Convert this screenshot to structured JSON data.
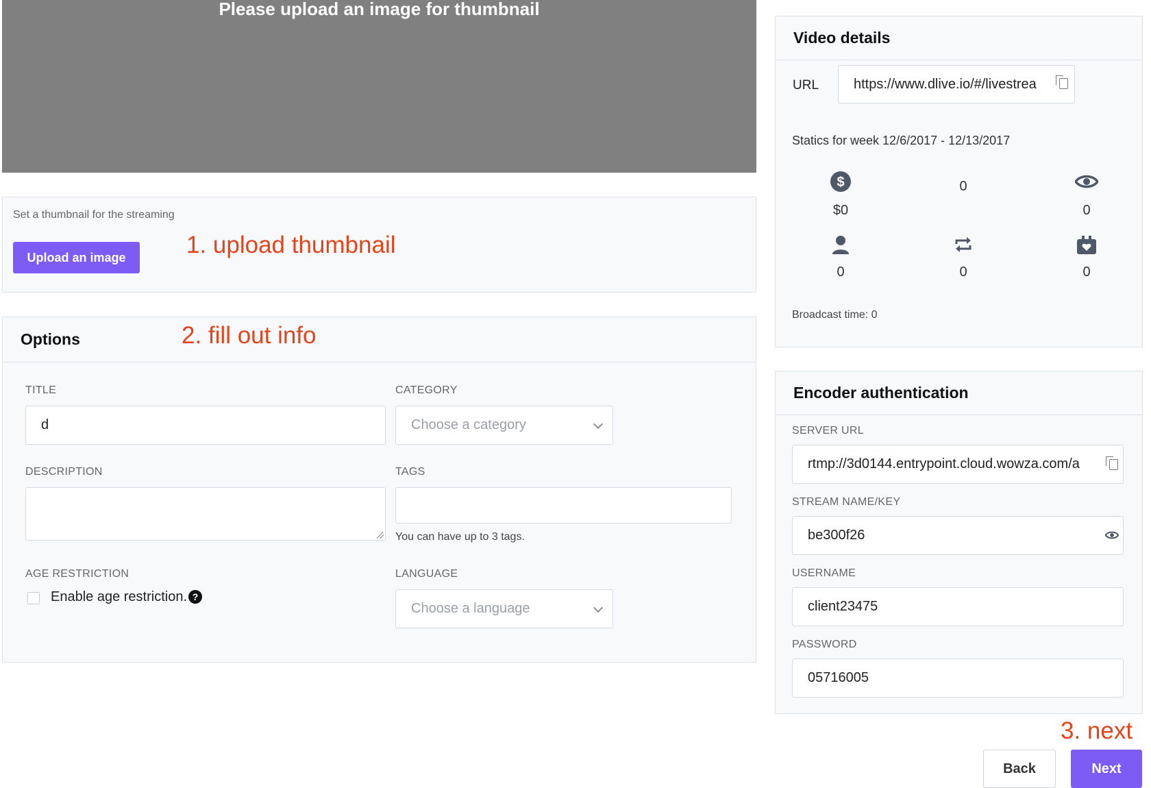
{
  "thumbnail": {
    "preview_message": "Please upload an image for thumbnail",
    "hint": "Set a thumbnail for the streaming",
    "upload_label": "Upload an image"
  },
  "annotations": {
    "step1": "1. upload thumbnail",
    "step2": "2. fill out info",
    "step3": "3. next"
  },
  "options": {
    "heading": "Options",
    "title_label": "TITLE",
    "title_value": "d",
    "category_label": "CATEGORY",
    "category_placeholder": "Choose a category",
    "description_label": "DESCRIPTION",
    "description_value": "",
    "tags_label": "TAGS",
    "tags_value": "",
    "tags_hint": "You can have up to 3 tags.",
    "age_label": "AGE RESTRICTION",
    "age_checkbox_label": "Enable age restriction.",
    "language_label": "LANGUAGE",
    "language_placeholder": "Choose a language"
  },
  "video_details": {
    "heading": "Video details",
    "url_label": "URL",
    "url_value": "https://www.dlive.io/#/livestrea",
    "stats_week": "Statics for week 12/6/2017 - 12/13/2017",
    "stats": [
      {
        "icon": "dollar-icon",
        "value": "$0"
      },
      {
        "icon": "none",
        "value": "0"
      },
      {
        "icon": "eye-icon",
        "value": "0"
      },
      {
        "icon": "user-icon",
        "value": "0"
      },
      {
        "icon": "repost-icon",
        "value": "0"
      },
      {
        "icon": "gift-icon",
        "value": "0"
      }
    ],
    "broadcast_time": "Broadcast time: 0"
  },
  "encoder": {
    "heading": "Encoder authentication",
    "server_url_label": "SERVER URL",
    "server_url_value": "rtmp://3d0144.entrypoint.cloud.wowza.com/a",
    "stream_key_label": "STREAM NAME/KEY",
    "stream_key_value": "be300f26",
    "username_label": "USERNAME",
    "username_value": "client23475",
    "password_label": "PASSWORD",
    "password_value": "05716005"
  },
  "actions": {
    "back_label": "Back",
    "next_label": "Next"
  },
  "colors": {
    "accent": "#7c5cf5",
    "annotation": "#e2451c",
    "preview_bg": "#808080",
    "icon": "#4e5866"
  }
}
